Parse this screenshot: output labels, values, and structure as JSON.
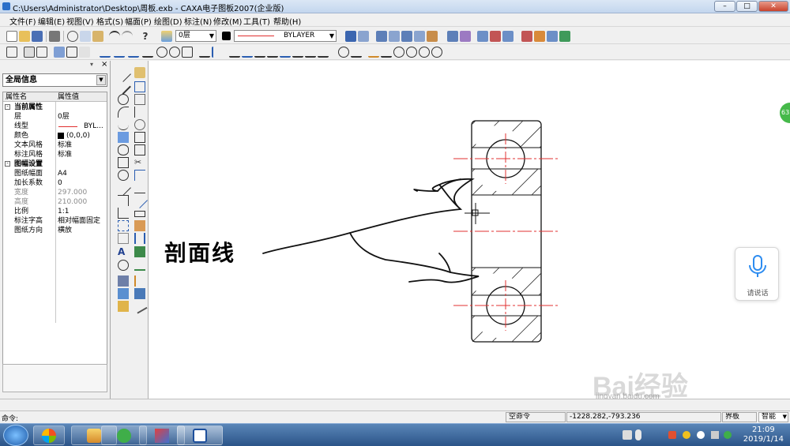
{
  "window": {
    "title": "C:\\Users\\Administrator\\Desktop\\周板.exb - CAXA电子图板2007(企业版)",
    "minimize_label": "–",
    "maximize_label": "□",
    "close_label": "✕"
  },
  "menu": {
    "items": [
      "文件(F)",
      "编辑(E)",
      "视图(V)",
      "格式(S)",
      "幅面(P)",
      "绘图(D)",
      "标注(N)",
      "修改(M)",
      "工具(T)",
      "帮助(H)"
    ]
  },
  "toolbar": {
    "layer_value": "0层",
    "linetype_value": "BYLAYER"
  },
  "panel": {
    "close_glyph": "×",
    "combo_value": "全局信息",
    "header_name": "属性名",
    "header_value": "属性值",
    "group1_label": "当前属性",
    "group2_label": "图幅设置",
    "rows1": [
      {
        "name": "层",
        "value": "0层"
      },
      {
        "name": "线型",
        "value": "BYL..."
      },
      {
        "name": "颜色",
        "value": "(0,0,0)"
      },
      {
        "name": "文本风格",
        "value": "标准"
      },
      {
        "name": "标注风格",
        "value": "标准"
      }
    ],
    "rows2": [
      {
        "name": "图纸幅面",
        "value": "A4"
      },
      {
        "name": "加长系数",
        "value": "0"
      },
      {
        "name": "宽度",
        "value": "297.000"
      },
      {
        "name": "高度",
        "value": "210.000"
      },
      {
        "name": "比例",
        "value": "1:1"
      },
      {
        "name": "标注字高",
        "value": "相对幅面固定"
      },
      {
        "name": "图纸方向",
        "value": "横放"
      }
    ]
  },
  "canvas": {
    "annotation_text": "剖面线"
  },
  "status": {
    "command_label": "命令:",
    "empty_command": "空命令",
    "coords": "-1228.282,-793.236",
    "mode_ortho": "界板",
    "mode_smart": "智能"
  },
  "voice": {
    "label": "请说话"
  },
  "badge": {
    "value": "63"
  },
  "watermark": {
    "brand": "Bai经验",
    "url": "jingyan.baidu.com"
  },
  "taskbar": {
    "time": "21:09",
    "date": "2019/1/14"
  },
  "colors": {
    "drawing_red": "#e03030",
    "badge_green": "#46b94a",
    "voice_blue": "#2d8cf0"
  }
}
